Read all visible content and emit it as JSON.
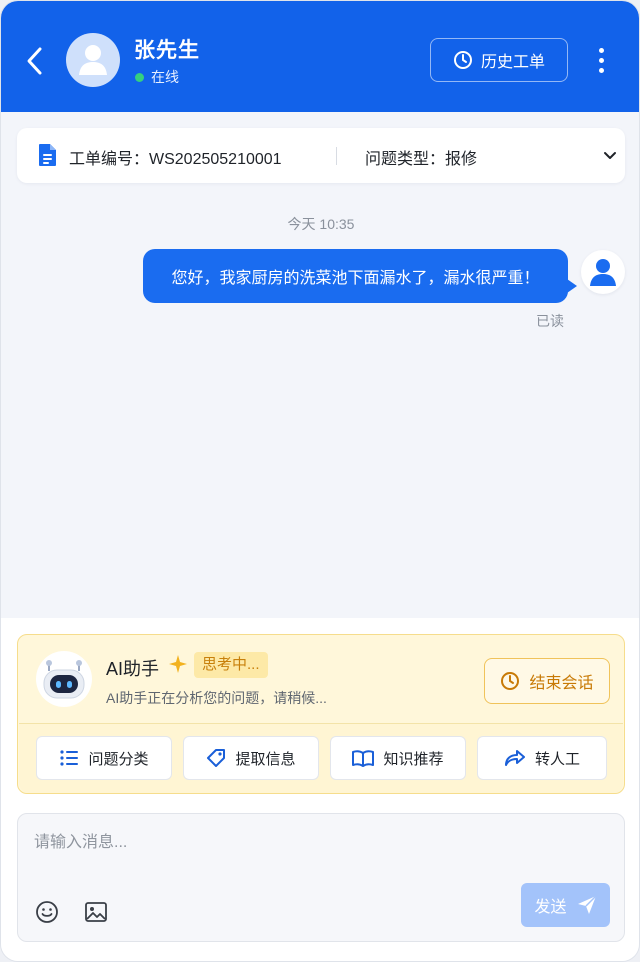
{
  "header": {
    "user_name": "张先生",
    "status_text": "在线",
    "history_label": "历史工单",
    "back_icon": "chevron-left-icon",
    "more_icon": "more-vertical-icon",
    "background": "#1262ea"
  },
  "ticket": {
    "number_text": "工单编号：WS202505210001",
    "type_text": "问题类型：报修"
  },
  "chat": {
    "timestamp": "今天 10:35",
    "messages": [
      {
        "text": "您好，我家厨房的洗菜池下面漏水了，漏水很严重！",
        "status": "已读"
      }
    ]
  },
  "ai_panel": {
    "title": "AI助手",
    "badge": "思考中...",
    "description": "AI助手正在分析您的问题，请稍候...",
    "end_label": "结束会话",
    "actions": [
      {
        "label": "问题分类",
        "icon": "list-icon"
      },
      {
        "label": "提取信息",
        "icon": "tag-icon"
      },
      {
        "label": "知识推荐",
        "icon": "book-icon"
      },
      {
        "label": "转人工",
        "icon": "share-icon"
      }
    ]
  },
  "composer": {
    "placeholder": "请输入消息...",
    "send_label": "发送"
  }
}
